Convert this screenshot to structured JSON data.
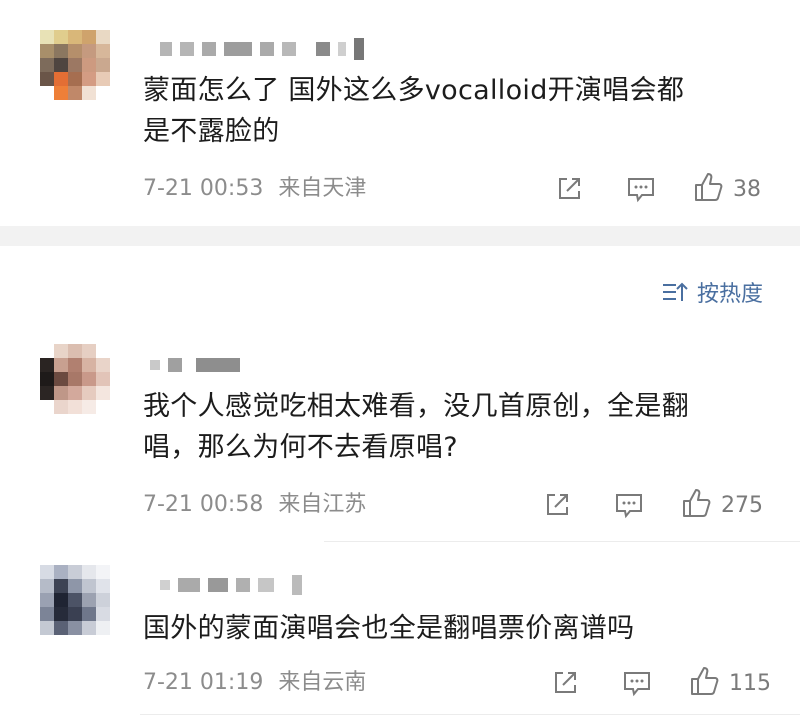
{
  "sort": {
    "label": "按热度",
    "icon": "sort-icon"
  },
  "comments": [
    {
      "text_line1": "蒙面怎么了 国外这么多vocalloid开演唱会都",
      "text_line2": "是不露脸的",
      "time": "7-21 00:53",
      "location": "来自天津",
      "likes": "38"
    },
    {
      "text_line1": "我个人感觉吃相太难看，没几首原创，全是翻",
      "text_line2": "唱，那么为何不去看原唱?",
      "time": "7-21 00:58",
      "location": "来自江苏",
      "likes": "275"
    },
    {
      "text_line1": "国外的蒙面演唱会也全是翻唱票价离谱吗",
      "time": "7-21 01:19",
      "location": "来自云南",
      "likes": "115"
    }
  ],
  "icons": {
    "share": "share-icon",
    "comment": "comment-icon",
    "like": "like-icon"
  },
  "colors": {
    "meta_gray": "#8c8c8c",
    "sort_blue": "#4a6fa0",
    "band_gray": "#f2f2f2"
  }
}
